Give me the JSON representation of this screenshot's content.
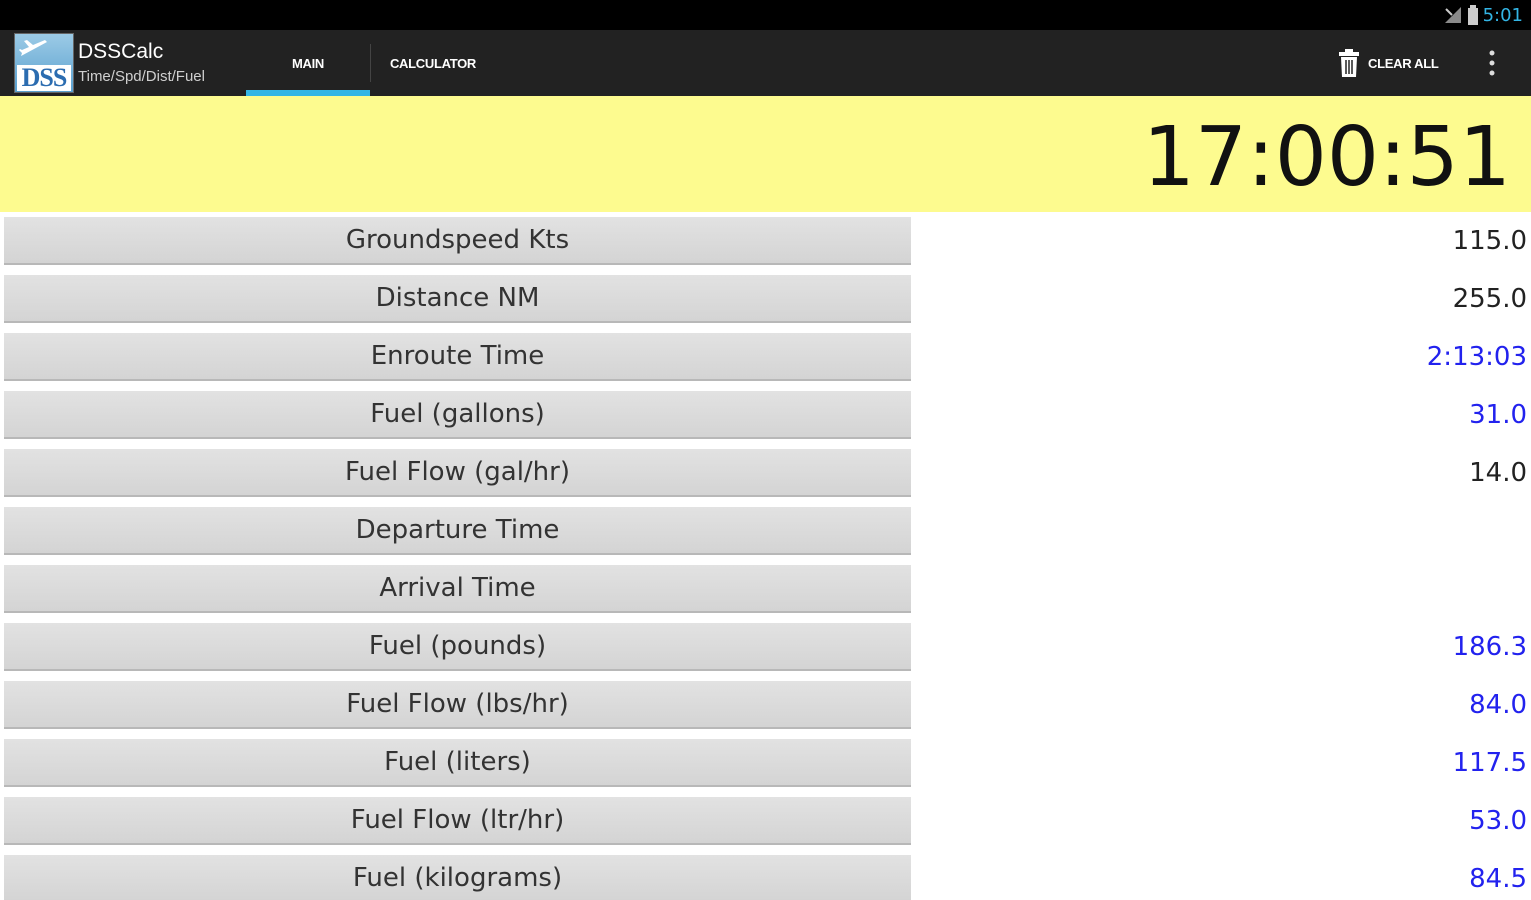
{
  "status": {
    "time": "5:01",
    "clock_color": "#33b5e5"
  },
  "app": {
    "title": "DSSCalc",
    "subtitle": "Time/Spd/Dist/Fuel",
    "icon_text": "DSS"
  },
  "tabs": [
    {
      "label": "MAIN",
      "selected": true
    },
    {
      "label": "CALCULATOR",
      "selected": false
    }
  ],
  "actions": {
    "clear_all_label": "CLEAR ALL"
  },
  "clock": {
    "time": "17:00:51",
    "background": "#fdfb8f"
  },
  "colors": {
    "input_value": "#222222",
    "computed_value": "#2222ee",
    "accent": "#33b5e5"
  },
  "rows": [
    {
      "label": "Groundspeed Kts",
      "value": "115.0",
      "computed": false
    },
    {
      "label": "Distance NM",
      "value": "255.0",
      "computed": false
    },
    {
      "label": "Enroute Time",
      "value": "2:13:03",
      "computed": true
    },
    {
      "label": "Fuel (gallons)",
      "value": "31.0",
      "computed": true
    },
    {
      "label": "Fuel Flow (gal/hr)",
      "value": "14.0",
      "computed": false
    },
    {
      "label": "Departure Time",
      "value": "",
      "computed": false
    },
    {
      "label": "Arrival Time",
      "value": "",
      "computed": false
    },
    {
      "label": "Fuel (pounds)",
      "value": "186.3",
      "computed": true
    },
    {
      "label": "Fuel Flow (lbs/hr)",
      "value": "84.0",
      "computed": true
    },
    {
      "label": "Fuel (liters)",
      "value": "117.5",
      "computed": true
    },
    {
      "label": "Fuel Flow (ltr/hr)",
      "value": "53.0",
      "computed": true
    },
    {
      "label": "Fuel (kilograms)",
      "value": "84.5",
      "computed": true
    }
  ]
}
